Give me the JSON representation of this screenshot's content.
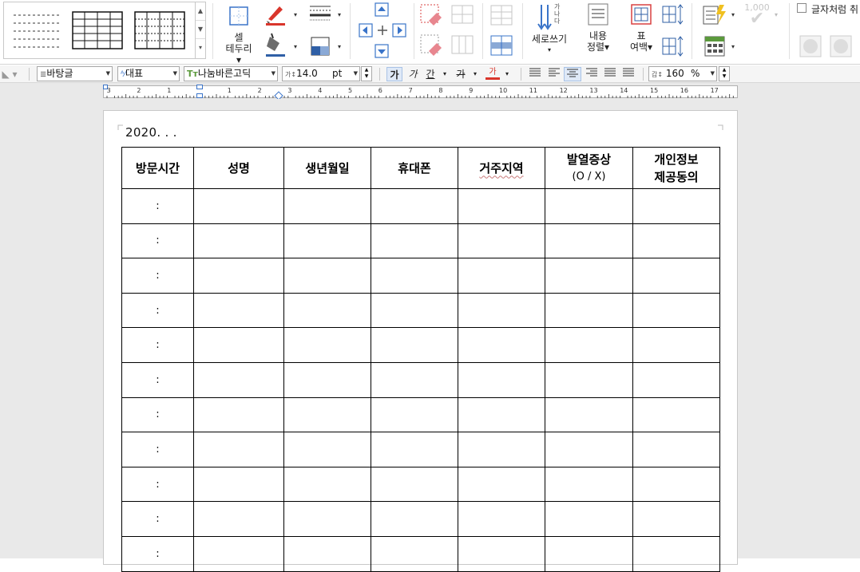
{
  "ribbon": {
    "cell_border_label_1": "셀",
    "cell_border_label_2": "테두리",
    "vertical_write_label": "세로쓰기",
    "vertical_glyphs": [
      "가",
      "나",
      "다"
    ],
    "content_align_label_1": "내용",
    "content_align_label_2": "정렬",
    "table_margin_label_1": "표",
    "table_margin_label_2": "여백",
    "number_format_value": "1,000",
    "checkbox_label": "글자처럼 취"
  },
  "format_bar": {
    "style": "바탕글",
    "language": "대표",
    "font_name": "나눔바른고딕",
    "font_size": "14.0",
    "font_unit": "pt",
    "bold_glyph": "가",
    "italic_glyph": "가",
    "underline_glyph": "간",
    "strike_glyph": "가",
    "color_glyph": "가",
    "line_spacing_value": "160",
    "line_spacing_unit": "%"
  },
  "ruler": {
    "numbers": [
      "3",
      "2",
      "1",
      "1",
      "2",
      "3",
      "4",
      "5",
      "6",
      "7",
      "8",
      "9",
      "10",
      "11",
      "12",
      "13",
      "14",
      "15",
      "16",
      "17"
    ]
  },
  "document": {
    "date_line": "2020.      .        .",
    "table": {
      "headers": [
        {
          "line1": "방문시간",
          "line2": ""
        },
        {
          "line1": "성명",
          "line2": ""
        },
        {
          "line1": "생년월일",
          "line2": ""
        },
        {
          "line1": "휴대폰",
          "line2": ""
        },
        {
          "line1": "거주지역",
          "line2": ""
        },
        {
          "line1": "발열증상",
          "line2": "(O  /  X)"
        },
        {
          "line1": "개인정보",
          "line2": "제공동의"
        }
      ],
      "rows": [
        [
          ":",
          "",
          "",
          "",
          "",
          "",
          ""
        ],
        [
          ":",
          "",
          "",
          "",
          "",
          "",
          ""
        ],
        [
          ":",
          "",
          "",
          "",
          "",
          "",
          ""
        ],
        [
          ":",
          "",
          "",
          "",
          "",
          "",
          ""
        ],
        [
          ":",
          "",
          "",
          "",
          "",
          "",
          ""
        ],
        [
          ":",
          "",
          "",
          "",
          "",
          "",
          ""
        ],
        [
          ":",
          "",
          "",
          "",
          "",
          "",
          ""
        ],
        [
          ":",
          "",
          "",
          "",
          "",
          "",
          ""
        ],
        [
          ":",
          "",
          "",
          "",
          "",
          "",
          ""
        ],
        [
          ":",
          "",
          "",
          "",
          "",
          "",
          ""
        ],
        [
          ":",
          "",
          "",
          "",
          "",
          "",
          ""
        ]
      ]
    }
  },
  "icons": {
    "cell_border": "cell-border-icon",
    "pen_color": "brush-icon",
    "fill_color": "paint-bucket-icon",
    "line_style": "line-style-icon",
    "cell_shade": "cell-shade-icon",
    "insert": "insert-cells-icon",
    "erase": "eraser-icon",
    "vertical": "vertical-text-icon",
    "align": "content-align-icon",
    "margin": "table-margin-icon",
    "autofit": "autofit-icon",
    "calc": "calculate-icon",
    "formula": "formula-icon"
  },
  "colors": {
    "brush_red": "#d9352b",
    "bucket_blue": "#2f5fa6",
    "table_red": "#d94040",
    "blue_arrow": "#3a74c9",
    "pink_eraser": "#e8868f",
    "green_calc": "#5b9a3c",
    "yellow_bolt": "#f0c020"
  }
}
